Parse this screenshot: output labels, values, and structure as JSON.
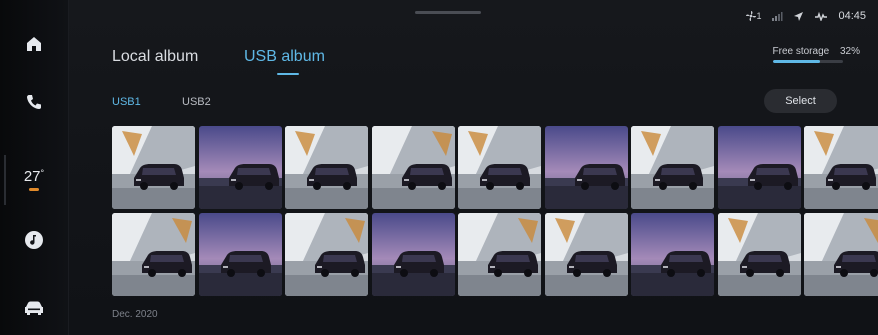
{
  "rail": {
    "temperature": "27",
    "temp_unit": "°",
    "temp_bar_color": "#e08a2a",
    "items": [
      {
        "icon": "home-icon"
      },
      {
        "icon": "phone-icon"
      },
      {
        "icon": "temperature"
      },
      {
        "icon": "music-icon"
      },
      {
        "icon": "car-icon"
      }
    ]
  },
  "status": {
    "signal_label": "1",
    "time": "04:45",
    "icons": [
      "fan-icon",
      "signal-bars-icon",
      "navigation-arrow-icon",
      "connection-icon"
    ]
  },
  "tabs": [
    {
      "label": "Local album",
      "active": false
    },
    {
      "label": "USB album",
      "active": true
    }
  ],
  "storage": {
    "label": "Free storage",
    "percent_text": "32%",
    "used_fraction": 0.68,
    "fill_color": "#5fb8e6"
  },
  "subtabs": [
    {
      "label": "USB1",
      "active": true
    },
    {
      "label": "USB2",
      "active": false
    }
  ],
  "select_label": "Select",
  "gallery": {
    "rows": [
      [
        "building",
        "dusk",
        "building",
        "building",
        "building",
        "dusk",
        "building",
        "dusk",
        "building"
      ],
      [
        "building",
        "dusk",
        "building",
        "dusk",
        "building",
        "building",
        "dusk",
        "building",
        "building"
      ]
    ]
  },
  "date_label": "Dec. 2020",
  "colors": {
    "accent": "#5fb8e6",
    "background": "#121418"
  }
}
